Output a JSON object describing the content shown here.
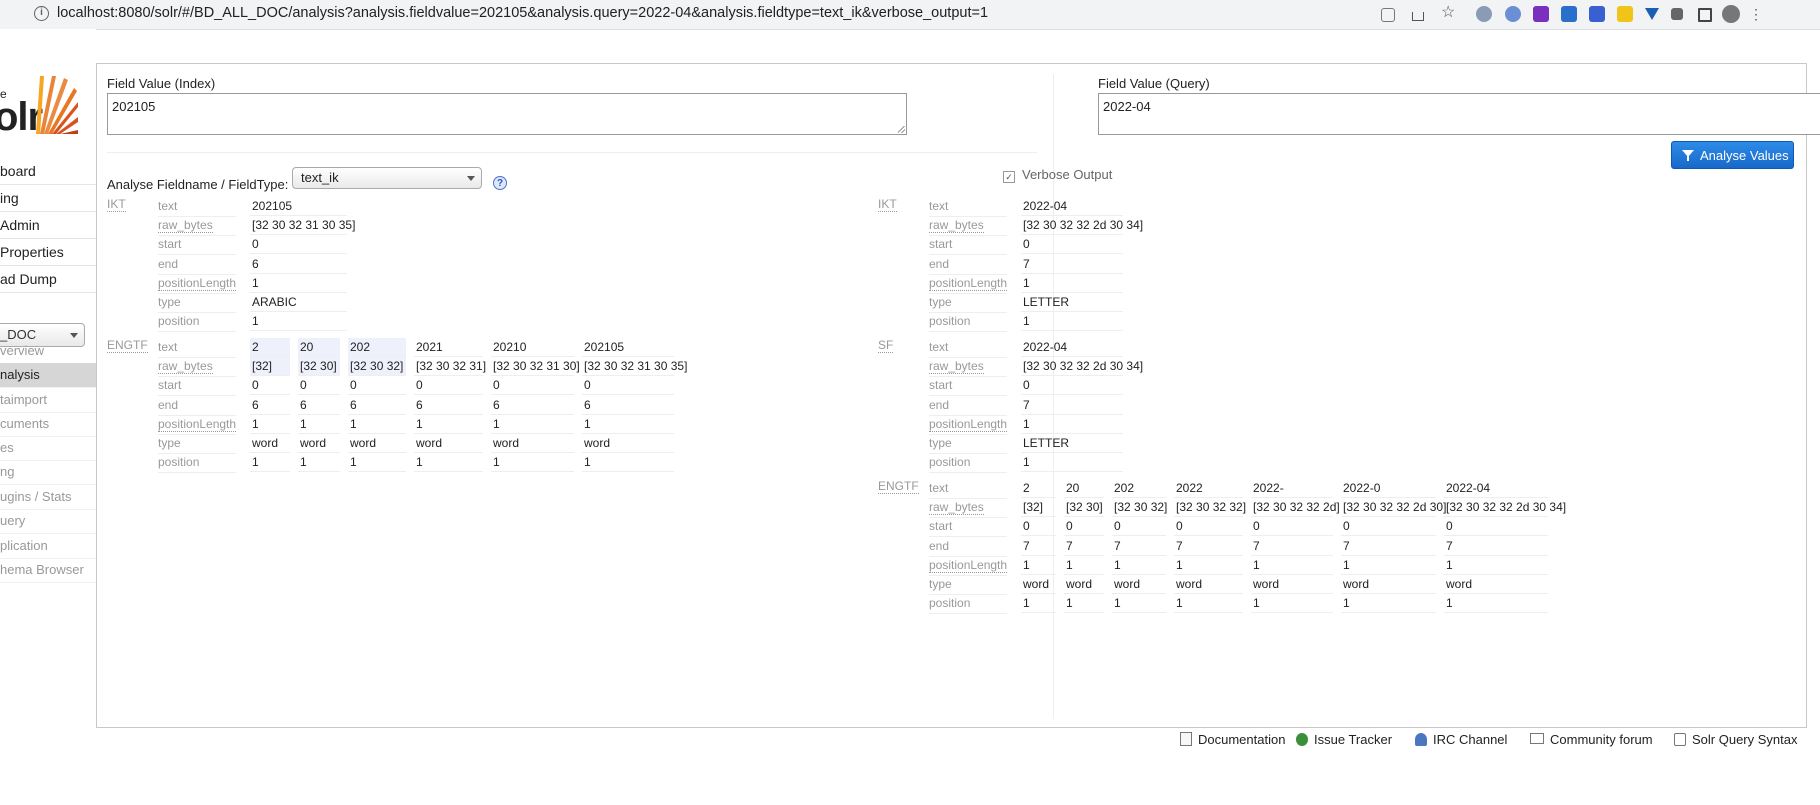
{
  "browser": {
    "url": "localhost:8080/solr/#/BD_ALL_DOC/analysis?analysis.fieldvalue=202105&analysis.query=2022-04&analysis.fieldtype=text_ik&verbose_output=1"
  },
  "sidebar": {
    "logo_small": "e",
    "logo_text": "olr",
    "nav": [
      "board",
      "ing",
      " Admin",
      " Properties",
      "ad Dump"
    ],
    "core_selected": "_DOC",
    "core_menu": [
      "verview",
      "nalysis",
      "taimport",
      "cuments",
      "es",
      "ng",
      "ugins / Stats",
      "uery",
      "plication",
      "hema Browser"
    ]
  },
  "form": {
    "index_label": "Field Value (Index)",
    "index_value": "202105",
    "query_label": "Field Value (Query)",
    "query_value": "2022-04",
    "fieldtype_label": "Analyse Fieldname / FieldType:",
    "fieldtype_value": "text_ik",
    "help": "?",
    "verbose_label": "Verbose Output",
    "analyse_button": "Analyse Values"
  },
  "attrs": [
    "text",
    "raw_bytes",
    "start",
    "end",
    "positionLength",
    "type",
    "position"
  ],
  "index_stages": [
    {
      "name": "IKT",
      "tokens": [
        {
          "text": "202105",
          "raw_bytes": "[32 30 32 31 30 35]",
          "start": "0",
          "end": "6",
          "positionLength": "1",
          "type": "ARABIC",
          "position": "1"
        }
      ]
    },
    {
      "name": "ENGTF",
      "tokens": [
        {
          "text": "2",
          "raw_bytes": "[32]",
          "start": "0",
          "end": "6",
          "positionLength": "1",
          "type": "word",
          "position": "1"
        },
        {
          "text": "20",
          "raw_bytes": "[32 30]",
          "start": "0",
          "end": "6",
          "positionLength": "1",
          "type": "word",
          "position": "1"
        },
        {
          "text": "202",
          "raw_bytes": "[32 30 32]",
          "start": "0",
          "end": "6",
          "positionLength": "1",
          "type": "word",
          "position": "1"
        },
        {
          "text": "2021",
          "raw_bytes": "[32 30 32 31]",
          "start": "0",
          "end": "6",
          "positionLength": "1",
          "type": "word",
          "position": "1"
        },
        {
          "text": "20210",
          "raw_bytes": "[32 30 32 31 30]",
          "start": "0",
          "end": "6",
          "positionLength": "1",
          "type": "word",
          "position": "1"
        },
        {
          "text": "202105",
          "raw_bytes": "[32 30 32 31 30 35]",
          "start": "0",
          "end": "6",
          "positionLength": "1",
          "type": "word",
          "position": "1"
        }
      ]
    }
  ],
  "query_stages": [
    {
      "name": "IKT",
      "tokens": [
        {
          "text": "2022-04",
          "raw_bytes": "[32 30 32 32 2d 30 34]",
          "start": "0",
          "end": "7",
          "positionLength": "1",
          "type": "LETTER",
          "position": "1"
        }
      ]
    },
    {
      "name": "SF",
      "tokens": [
        {
          "text": "2022-04",
          "raw_bytes": "[32 30 32 32 2d 30 34]",
          "start": "0",
          "end": "7",
          "positionLength": "1",
          "type": "LETTER",
          "position": "1"
        }
      ]
    },
    {
      "name": "ENGTF",
      "tokens": [
        {
          "text": "2",
          "raw_bytes": "[32]",
          "start": "0",
          "end": "7",
          "positionLength": "1",
          "type": "word",
          "position": "1"
        },
        {
          "text": "20",
          "raw_bytes": "[32 30]",
          "start": "0",
          "end": "7",
          "positionLength": "1",
          "type": "word",
          "position": "1"
        },
        {
          "text": "202",
          "raw_bytes": "[32 30 32]",
          "start": "0",
          "end": "7",
          "positionLength": "1",
          "type": "word",
          "position": "1"
        },
        {
          "text": "2022",
          "raw_bytes": "[32 30 32 32]",
          "start": "0",
          "end": "7",
          "positionLength": "1",
          "type": "word",
          "position": "1"
        },
        {
          "text": "2022-",
          "raw_bytes": "[32 30 32 32 2d]",
          "start": "0",
          "end": "7",
          "positionLength": "1",
          "type": "word",
          "position": "1"
        },
        {
          "text": "2022-0",
          "raw_bytes": "[32 30 32 32 2d 30]",
          "start": "0",
          "end": "7",
          "positionLength": "1",
          "type": "word",
          "position": "1"
        },
        {
          "text": "2022-04",
          "raw_bytes": "[32 30 32 32 2d 30 34]",
          "start": "0",
          "end": "7",
          "positionLength": "1",
          "type": "word",
          "position": "1"
        }
      ]
    }
  ],
  "footer": [
    "Documentation",
    "Issue Tracker",
    "IRC Channel",
    "Community forum",
    "Solr Query Syntax"
  ],
  "icons": {
    "footer": [
      "document-icon",
      "bug-icon",
      "chat-icon",
      "mail-icon",
      "syntax-icon"
    ]
  }
}
